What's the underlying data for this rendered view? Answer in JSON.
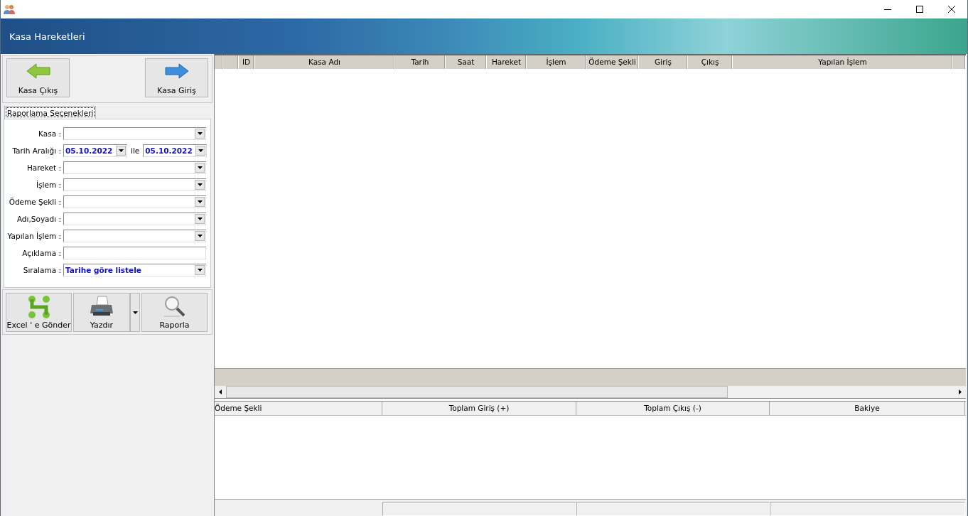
{
  "window": {
    "title": "Kasa Hareketleri"
  },
  "actions": [
    {
      "kind": "out",
      "label": "Kasa Çıkış"
    },
    {
      "kind": "in",
      "label": "Kasa Giriş"
    }
  ],
  "tabs": [
    {
      "label": "Raporlama Seçenekleri",
      "selected": true
    }
  ],
  "filters": [
    {
      "kind": "combo",
      "label": "Kasa :"
    },
    {
      "kind": "daterange",
      "label": "Tarih Aralığı :",
      "from": "05.10.2022",
      "joiner": "ile",
      "to": "05.10.2022"
    },
    {
      "kind": "combo",
      "label": "Hareket :"
    },
    {
      "kind": "combo",
      "label": "İşlem :"
    },
    {
      "kind": "combo",
      "label": "Ödeme Şekli :"
    },
    {
      "kind": "combo",
      "label": "Adı,Soyadı :"
    },
    {
      "kind": "combo",
      "label": "Yapılan İşlem :"
    },
    {
      "kind": "text",
      "label": "Açıklama :"
    },
    {
      "kind": "combo",
      "label": "Sıralama :",
      "value": "Tarihe göre listele"
    }
  ],
  "buttons": [
    {
      "kind": "excel",
      "label": "Excel ' e Gönder"
    },
    {
      "kind": "print",
      "label": "Yazdır"
    },
    {
      "kind": "report",
      "label": "Raporla"
    }
  ],
  "table": {
    "columns": [
      "ID",
      "Kasa Adı",
      "Tarih",
      "Saat",
      "Hareket",
      "İşlem",
      "Ödeme Şekli",
      "Giriş",
      "Çıkış",
      "Yapılan İşlem"
    ]
  },
  "summary": {
    "columns": [
      "Ödeme Şekli",
      "Toplam Giriş (+)",
      "Toplam Çıkış (-)",
      "Bakiye"
    ]
  }
}
